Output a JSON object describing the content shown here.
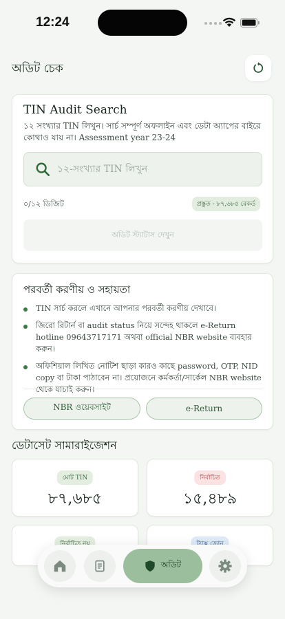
{
  "status_bar": {
    "time": "12:24"
  },
  "header": {
    "title": "অডিট চেক",
    "refresh_icon": "refresh-icon"
  },
  "search_card": {
    "title": "TIN Audit Search",
    "description": "১২ সংখ্যার TIN লিখুন। সার্চ সম্পূর্ণ অফলাইন এবং ডেটা অ্যাপের বাইরে কোথাও যায় না। Assessment year 23-24",
    "placeholder": "১২-সংখ্যার TIN লিখুন",
    "value": "",
    "digit_count": "০/১২ ডিজিট",
    "ready_badge": "প্রস্তুত - ৮৭,৬৮৫ রেকর্ড",
    "check_button": "অডিট স্ট্যাটাস দেখুন"
  },
  "help_card": {
    "title": "পরবর্তী করণীয় ও সহায়তা",
    "items": [
      "TIN সার্চ করলে এখানে আপনার পরবর্তী করণীয় দেখাবে।",
      "জিরো রিটার্ন বা audit status নিয়ে সন্দেহ থাকলে e-Return hotline 09643717171 অথবা official NBR website ব্যবহার করুন।",
      "অফিশিয়াল লিখিত নোটিশ ছাড়া কারও কাছে password, OTP, NID copy বা টাকা পাঠাবেন না। প্রয়োজনে কর্মকর্তা/সার্কেল NBR website থেকে যাচাই করুন।"
    ],
    "nbr_button": "NBR ওয়েবসাইট",
    "ereturn_button": "e-Return"
  },
  "dataset": {
    "title": "ডেটাসেট সামারাইজেশন",
    "stats": [
      {
        "label": "মোট TIN",
        "value": "৮৭,৬৮৫"
      },
      {
        "label": "নির্বাচিত",
        "value": "১৫,৪৮৯"
      },
      {
        "label": "নির্বাচিত নয়",
        "value": ""
      },
      {
        "label": "ট্যাক্স জোন",
        "value": ""
      }
    ]
  },
  "bottom_nav": {
    "audit_label": "অডিট",
    "icons": [
      "home-icon",
      "document-icon",
      "shield-icon",
      "gear-icon"
    ]
  },
  "colors": {
    "accent": "#3b7a44",
    "background": "#f3f6f2",
    "nav_active": "#9bbf9c",
    "danger_chip": "#fbe3e3"
  }
}
